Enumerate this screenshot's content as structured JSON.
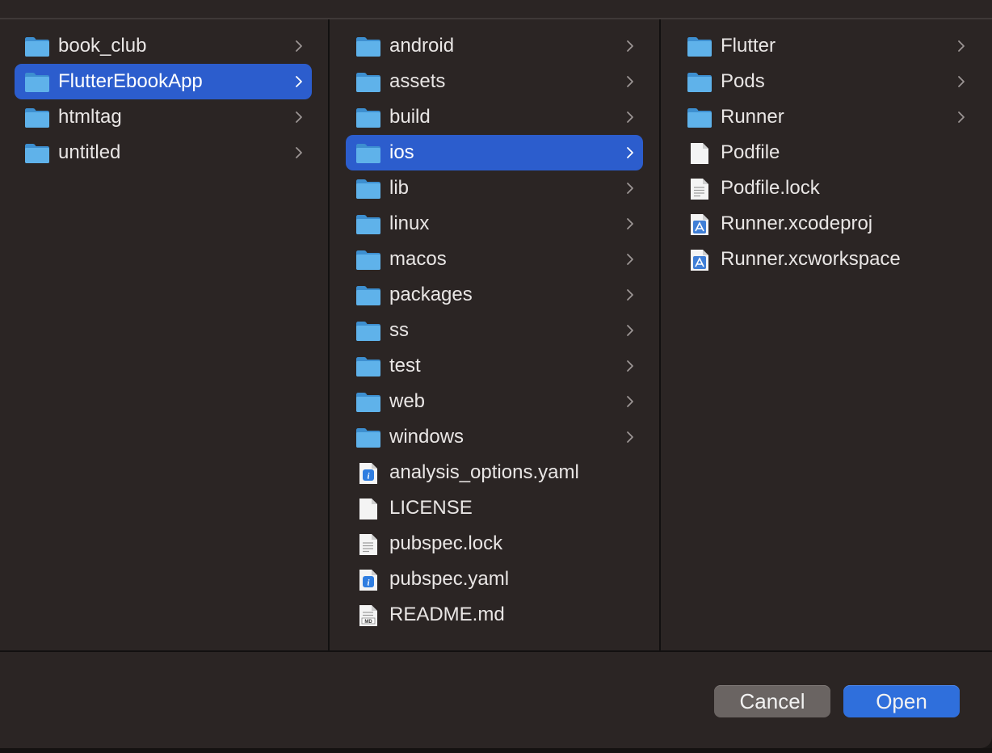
{
  "columns": [
    {
      "items": [
        {
          "label": "book_club",
          "type": "folder",
          "chevron": true,
          "selected": false
        },
        {
          "label": "FlutterEbookApp",
          "type": "folder",
          "chevron": true,
          "selected": true
        },
        {
          "label": "htmltag",
          "type": "folder",
          "chevron": true,
          "selected": false
        },
        {
          "label": "untitled",
          "type": "folder",
          "chevron": true,
          "selected": false
        }
      ]
    },
    {
      "items": [
        {
          "label": "android",
          "type": "folder",
          "chevron": true,
          "selected": false
        },
        {
          "label": "assets",
          "type": "folder",
          "chevron": true,
          "selected": false
        },
        {
          "label": "build",
          "type": "folder",
          "chevron": true,
          "selected": false
        },
        {
          "label": "ios",
          "type": "folder",
          "chevron": true,
          "selected": true
        },
        {
          "label": "lib",
          "type": "folder",
          "chevron": true,
          "selected": false
        },
        {
          "label": "linux",
          "type": "folder",
          "chevron": true,
          "selected": false
        },
        {
          "label": "macos",
          "type": "folder",
          "chevron": true,
          "selected": false
        },
        {
          "label": "packages",
          "type": "folder",
          "chevron": true,
          "selected": false
        },
        {
          "label": "ss",
          "type": "folder",
          "chevron": true,
          "selected": false
        },
        {
          "label": "test",
          "type": "folder",
          "chevron": true,
          "selected": false
        },
        {
          "label": "web",
          "type": "folder",
          "chevron": true,
          "selected": false
        },
        {
          "label": "windows",
          "type": "folder",
          "chevron": true,
          "selected": false
        },
        {
          "label": "analysis_options.yaml",
          "type": "yaml-file",
          "chevron": false,
          "selected": false
        },
        {
          "label": "LICENSE",
          "type": "blank-file",
          "chevron": false,
          "selected": false
        },
        {
          "label": "pubspec.lock",
          "type": "text-file",
          "chevron": false,
          "selected": false
        },
        {
          "label": "pubspec.yaml",
          "type": "yaml-file",
          "chevron": false,
          "selected": false
        },
        {
          "label": "README.md",
          "type": "markdown-file",
          "chevron": false,
          "selected": false
        }
      ]
    },
    {
      "items": [
        {
          "label": "Flutter",
          "type": "folder",
          "chevron": true,
          "selected": false
        },
        {
          "label": "Pods",
          "type": "folder",
          "chevron": true,
          "selected": false
        },
        {
          "label": "Runner",
          "type": "folder",
          "chevron": true,
          "selected": false
        },
        {
          "label": "Podfile",
          "type": "blank-file",
          "chevron": false,
          "selected": false
        },
        {
          "label": "Podfile.lock",
          "type": "text-file",
          "chevron": false,
          "selected": false
        },
        {
          "label": "Runner.xcodeproj",
          "type": "xcode-file",
          "chevron": false,
          "selected": false
        },
        {
          "label": "Runner.xcworkspace",
          "type": "xcode-file",
          "chevron": false,
          "selected": false
        }
      ]
    }
  ],
  "buttons": {
    "cancel_label": "Cancel",
    "open_label": "Open"
  },
  "colors": {
    "selection": "#2c5dcd",
    "folder": "#5fb2ea",
    "dialog_bg": "#2b2524",
    "text": "#e9e6e5"
  }
}
